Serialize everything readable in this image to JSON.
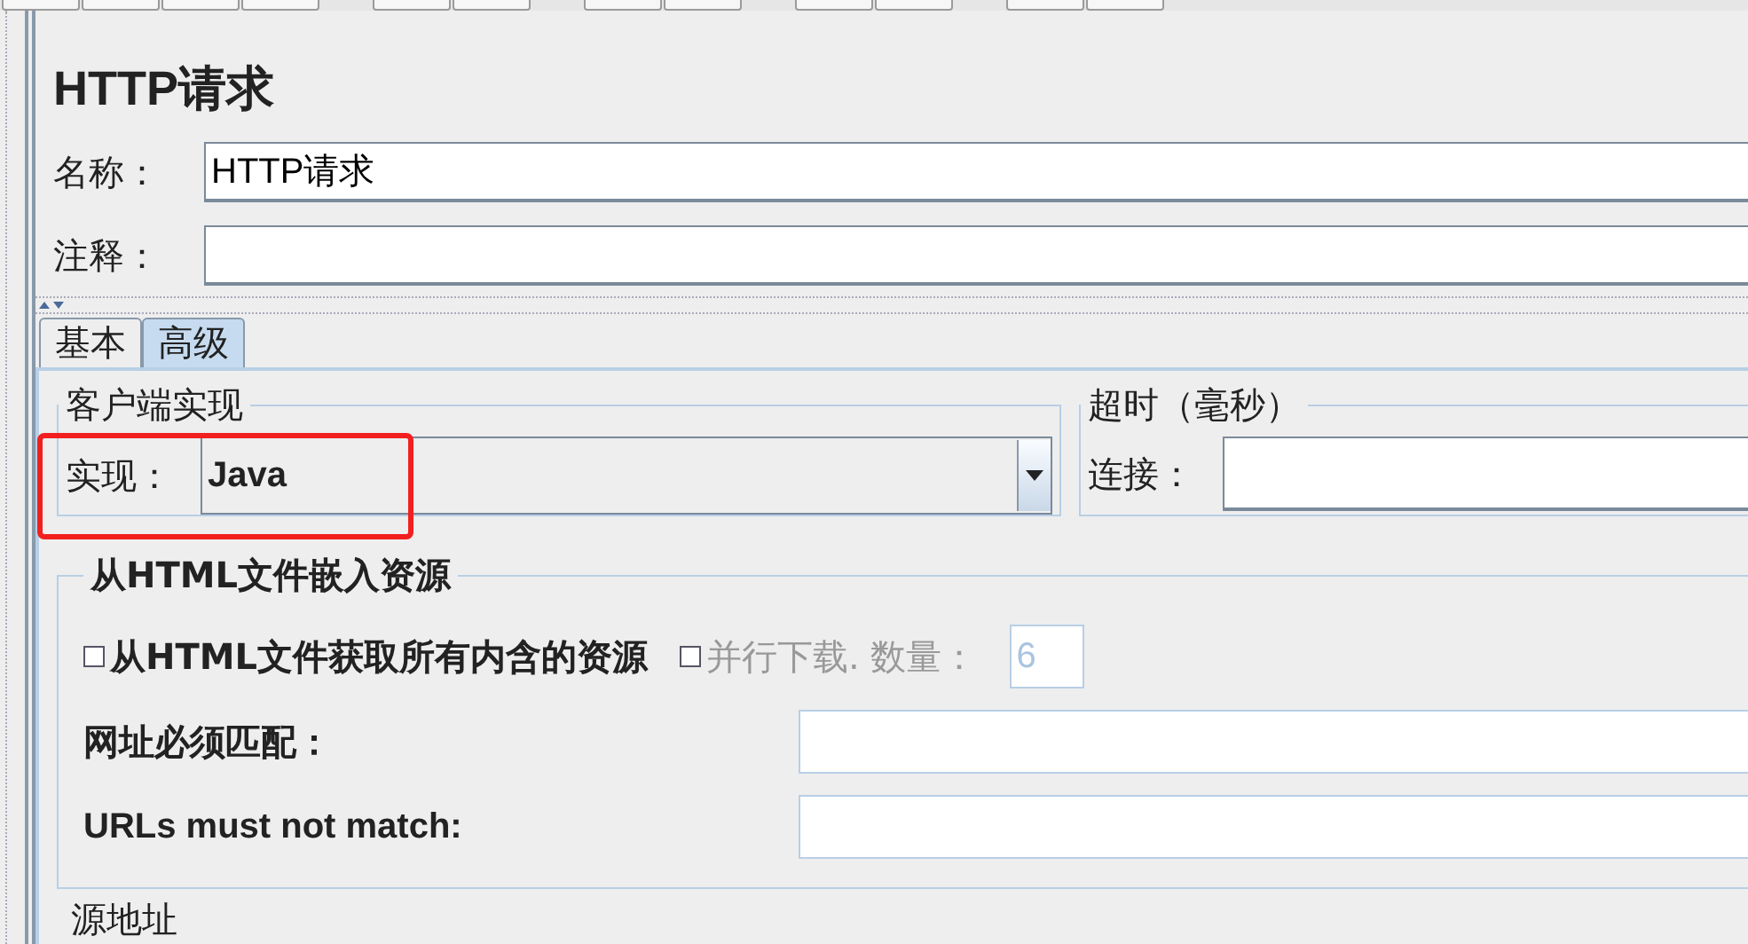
{
  "title": "HTTP请求",
  "fields": [
    {
      "label": "名称：",
      "value": "HTTP请求"
    },
    {
      "label": "注释："
    }
  ],
  "tabs": [
    {
      "label": "基本",
      "selected": false
    },
    {
      "label": "高级",
      "selected": true
    }
  ],
  "client_implementation": {
    "legend": "客户端实现",
    "label": "实现：",
    "value": "Java",
    "highlighted": true
  },
  "timeouts": {
    "legend": "超时（毫秒）",
    "label": "连接："
  },
  "embedded_resources": {
    "legend": "从HTML文件嵌入资源",
    "retrieve_all": {
      "label": "从HTML文件获取所有内含的资源",
      "checked": false
    },
    "parallel": {
      "label": "并行下载. 数量：",
      "checked": false,
      "disabled": true,
      "value": "6"
    },
    "url_fields": [
      {
        "label": "网址必须匹配："
      },
      {
        "label": "URLs must not match:"
      }
    ]
  },
  "next_section": "源地址"
}
